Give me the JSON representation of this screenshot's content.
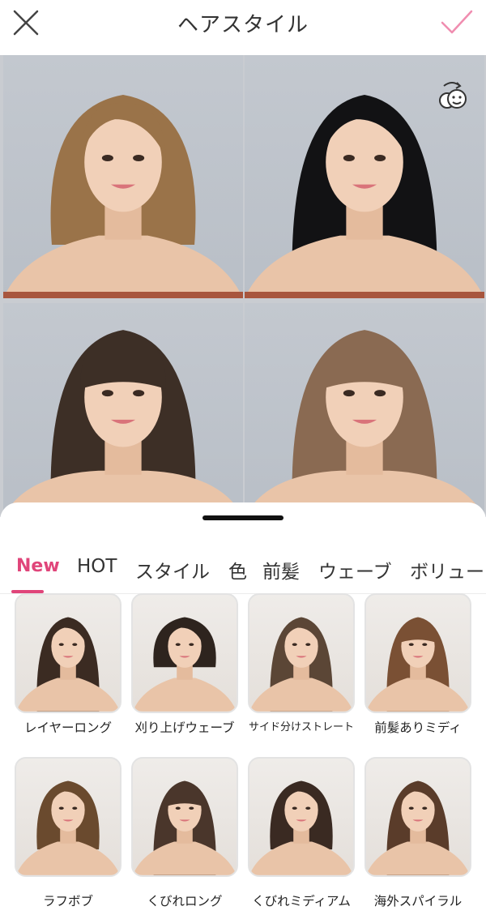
{
  "header": {
    "title": "ヘアスタイル",
    "close_icon": "close-icon",
    "confirm_icon": "checkmark-icon",
    "accent_color": "#e0457a"
  },
  "preview": {
    "swap_icon": "face-swap-icon",
    "tiles": [
      {
        "style": "bob-wavy-blonde",
        "hair_color": "#9a7349"
      },
      {
        "style": "long-straight-black",
        "hair_color": "#121214"
      },
      {
        "style": "medium-wavy-bangs-dark",
        "hair_color": "#3d2f26"
      },
      {
        "style": "long-straight-bangs-brown",
        "hair_color": "#8a6a52"
      }
    ]
  },
  "tabs": [
    {
      "label": "New",
      "active": true
    },
    {
      "label": "HOT"
    },
    {
      "label": "スタイル"
    },
    {
      "label": "色"
    },
    {
      "label": "前髪"
    },
    {
      "label": "ウェーブ"
    },
    {
      "label": "ボリュー"
    }
  ],
  "styles": [
    {
      "label": "レイヤーロング",
      "hair_color": "#3b2b22"
    },
    {
      "label": "刈り上げウェーブ",
      "hair_color": "#2e241e"
    },
    {
      "label": "サイド分けストレート",
      "hair_color": "#5b4636"
    },
    {
      "label": "前髪ありミディ",
      "hair_color": "#7a5034"
    },
    {
      "label": "ラフボブ",
      "hair_color": "#6a4a2e"
    },
    {
      "label": "くびれロング",
      "hair_color": "#4a362b"
    },
    {
      "label": "くびれミディアム",
      "hair_color": "#3a2a22"
    },
    {
      "label": "海外スパイラル",
      "hair_color": "#5a3c2a"
    }
  ]
}
